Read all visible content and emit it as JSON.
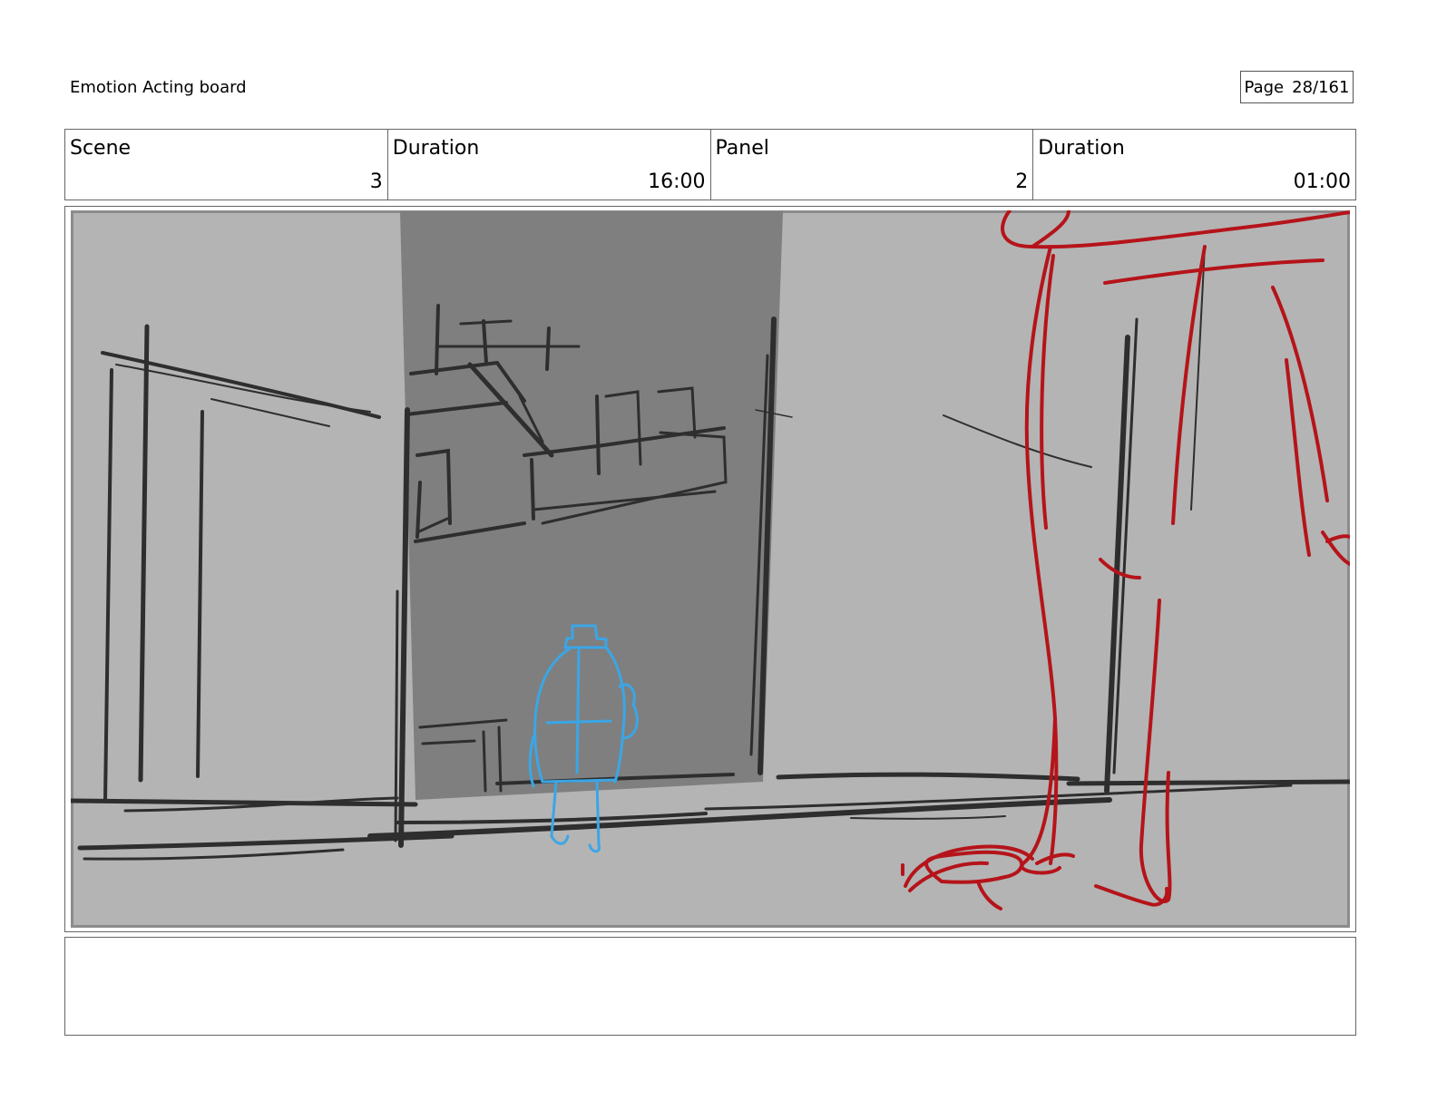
{
  "header": {
    "title": "Emotion Acting board",
    "page_label": "Page",
    "page_value": "28/161"
  },
  "info": {
    "scene_label": "Scene",
    "scene_value": "3",
    "scene_duration_label": "Duration",
    "scene_duration_value": "16:00",
    "panel_label": "Panel",
    "panel_value": "2",
    "panel_duration_label": "Duration",
    "panel_duration_value": "01:00"
  },
  "panel": {
    "description": "",
    "colors": {
      "background": "#b4b4b4",
      "alley": "#7f7f7f",
      "sketch": "#2e2e2e",
      "character_small": "#3aa6e6",
      "character_large": "#b5141a"
    }
  },
  "notes": {
    "text": ""
  }
}
